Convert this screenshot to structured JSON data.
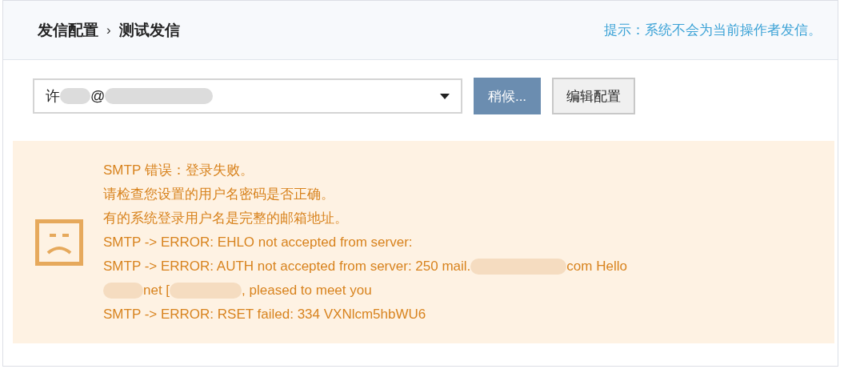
{
  "breadcrumb": [
    {
      "label": "发信配置"
    },
    {
      "label": "测试发信"
    }
  ],
  "breadcrumb_separator": "›",
  "hint": "提示：系统不会为当前操作者发信。",
  "sender_select": {
    "value": [
      {
        "kind": "text",
        "text": "许"
      },
      {
        "kind": "redacted"
      },
      {
        "kind": "text",
        "text": "@"
      },
      {
        "kind": "redacted"
      }
    ]
  },
  "buttons": [
    {
      "label": "稍候...",
      "disabled": true
    },
    {
      "label": "编辑配置",
      "disabled": false
    }
  ],
  "error": {
    "lines": [
      [
        {
          "kind": "text",
          "text": "SMTP 错误：登录失败。"
        }
      ],
      [
        {
          "kind": "text",
          "text": "请检查您设置的用户名密码是否正确。"
        }
      ],
      [
        {
          "kind": "text",
          "text": "有的系统登录用户名是完整的邮箱地址。"
        }
      ],
      [
        {
          "kind": "text",
          "text": "SMTP -> ERROR: EHLO not accepted from server:"
        }
      ],
      [
        {
          "kind": "text",
          "text": "SMTP -> ERROR: AUTH not accepted from server: 250 mail."
        },
        {
          "kind": "redacted"
        },
        {
          "kind": "text",
          "text": "com Hello"
        }
      ],
      [
        {
          "kind": "redacted"
        },
        {
          "kind": "text",
          "text": "net ["
        },
        {
          "kind": "redacted"
        },
        {
          "kind": "text",
          "text": ", pleased to meet you"
        }
      ],
      [
        {
          "kind": "text",
          "text": "SMTP -> ERROR: RSET failed: 334 VXNlcm5hbWU6"
        }
      ]
    ]
  }
}
